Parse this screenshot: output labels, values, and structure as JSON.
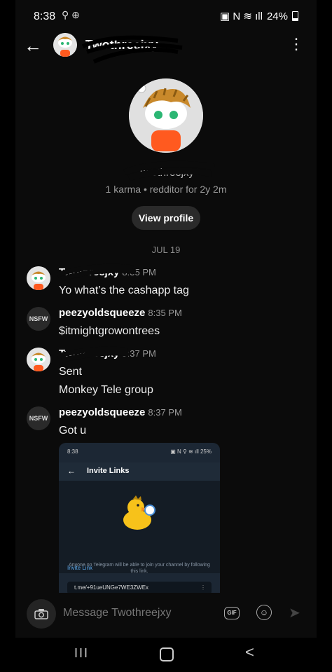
{
  "status_bar": {
    "time": "8:38",
    "battery": "24%",
    "left_icons": "⚲ ⊕",
    "right_icons": "▣ N ≋ ıll"
  },
  "header": {
    "back_glyph": "←",
    "title": "Twothreejxy",
    "menu_glyph": "⋮"
  },
  "profile": {
    "name": "Twothreejxy",
    "karma_line": "1 karma • redditor for 2y 2m",
    "view_profile_label": "View profile"
  },
  "date_separator": "JUL 19",
  "messages": [
    {
      "author": "Twothreejxy",
      "time": "8:35 PM",
      "lines": [
        "Yo what’s the cashapp tag"
      ],
      "avatar": "avatar-image"
    },
    {
      "author": "peezyoldsqueeze",
      "time": "8:35 PM",
      "lines": [
        "$itmightgrowontrees"
      ],
      "avatar": "NSFW"
    },
    {
      "author": "Twothreejxy",
      "time": "8:37 PM",
      "lines": [
        "Sent",
        "Monkey Tele group"
      ],
      "avatar": "avatar-image"
    },
    {
      "author": "peezyoldsqueeze",
      "time": "8:37 PM",
      "lines": [
        "Got u"
      ],
      "avatar": "NSFW"
    }
  ],
  "attachment": {
    "status_time": "8:38",
    "status_right": "▣ N ⚲ ≋ ıll 25%",
    "title": "Invite Links",
    "description": "Anyone on Telegram will be able to join your channel by following this link.",
    "link_label": "Invite Link",
    "link_value": "t.me/+91ueUNGe7WE3ZWEx"
  },
  "composer": {
    "placeholder": "Message Twothreejxy",
    "gif_label": "GIF",
    "camera_icon": "camera-icon",
    "emoji_icon": "emoji-icon",
    "send_icon": "send-icon"
  },
  "nav": {
    "recent_glyph": "III",
    "back_glyph": "<"
  },
  "colors": {
    "background": "#0b0b0b",
    "bubble": "#2a2a2a",
    "muted": "#9a9a9a",
    "link": "#5ba6e8"
  }
}
